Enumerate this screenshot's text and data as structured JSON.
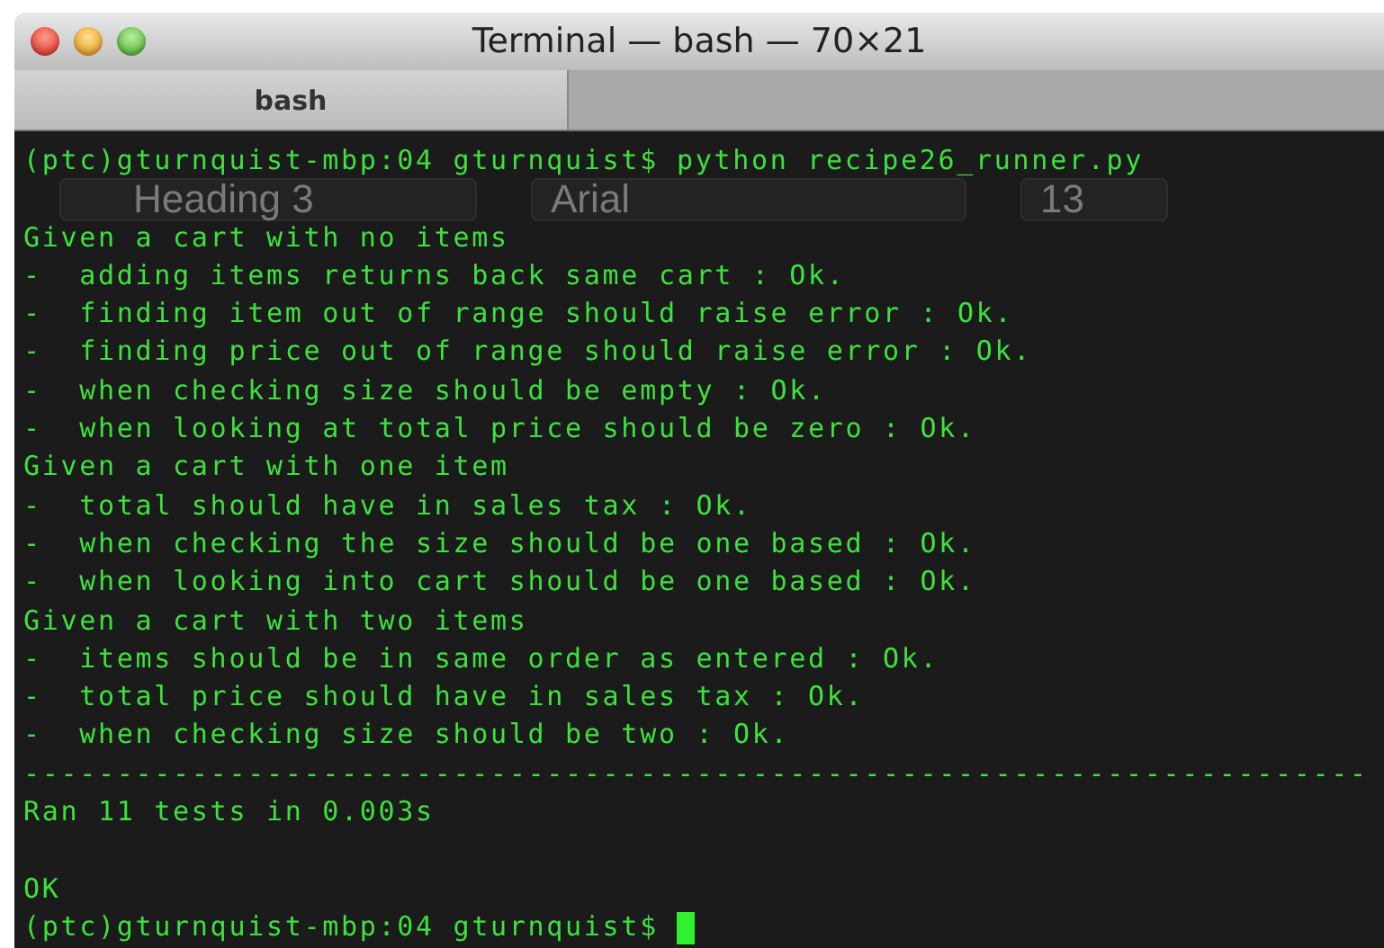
{
  "window": {
    "title": "Terminal — bash — 70×21"
  },
  "tabs": [
    {
      "label": "bash",
      "selected": true
    }
  ],
  "background_window": {
    "style_select": "Heading 3",
    "font_select": "Arial",
    "size_select": "13"
  },
  "lines": [
    {
      "kind": "prompt",
      "prompt": "(ptc)gturnquist-mbp:04 gturnquist$",
      "command": "python recipe26_runner.py",
      "cursor": false
    },
    {
      "kind": "ghost"
    },
    {
      "kind": "text",
      "text": "Given a cart with no items"
    },
    {
      "kind": "text",
      "text": "-  adding items returns back same cart : Ok."
    },
    {
      "kind": "text",
      "text": "-  finding item out of range should raise error : Ok."
    },
    {
      "kind": "text",
      "text": "-  finding price out of range should raise error : Ok."
    },
    {
      "kind": "text",
      "text": "-  when checking size should be empty : Ok."
    },
    {
      "kind": "text",
      "text": "-  when looking at total price should be zero : Ok."
    },
    {
      "kind": "text",
      "text": "Given a cart with one item"
    },
    {
      "kind": "text",
      "text": "-  total should have in sales tax : Ok."
    },
    {
      "kind": "text",
      "text": "-  when checking the size should be one based : Ok."
    },
    {
      "kind": "text",
      "text": "-  when looking into cart should be one based : Ok."
    },
    {
      "kind": "text",
      "text": "Given a cart with two items"
    },
    {
      "kind": "text",
      "text": "-  items should be in same order as entered : Ok."
    },
    {
      "kind": "text",
      "text": "-  total price should have in sales tax : Ok."
    },
    {
      "kind": "text",
      "text": "-  when checking size should be two : Ok."
    },
    {
      "kind": "text",
      "text": "------------------------------------------------------------------------"
    },
    {
      "kind": "text",
      "text": "Ran 11 tests in 0.003s"
    },
    {
      "kind": "blank"
    },
    {
      "kind": "text",
      "text": "OK"
    },
    {
      "kind": "prompt",
      "prompt": "(ptc)gturnquist-mbp:04 gturnquist$",
      "cursor": true
    }
  ]
}
